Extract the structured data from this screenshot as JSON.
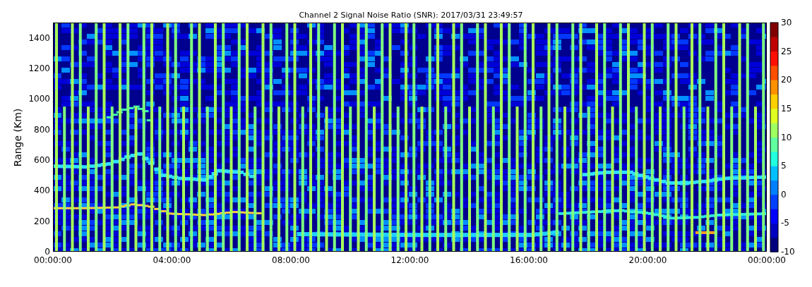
{
  "title": "Channel 2 Signal Noise Ratio (SNR): 2017/03/31 23:49:57",
  "y_axis": {
    "label": "Range (Km)",
    "ticks": [
      "1400",
      "1200",
      "1000",
      "800",
      "600",
      "400",
      "200",
      "0"
    ]
  },
  "x_axis": {
    "ticks": [
      "00:00:00",
      "04:00:00",
      "08:00:00",
      "12:00:00",
      "16:00:00",
      "20:00:00",
      "00:00:00"
    ]
  },
  "colorbar": {
    "ticks": [
      "30",
      "25",
      "20",
      "15",
      "10",
      "5",
      "0",
      "-5",
      "-10"
    ]
  }
}
